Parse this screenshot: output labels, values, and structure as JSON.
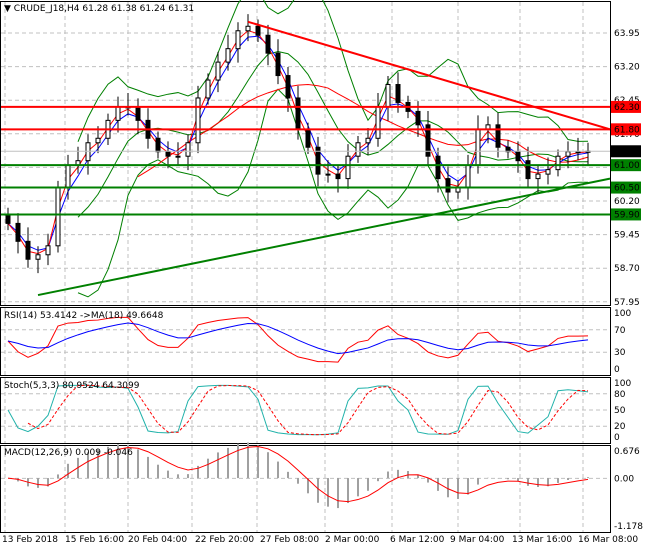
{
  "header": {
    "symbol": "CRUDE_J18,H4",
    "open": "61.28",
    "high": "61.38",
    "low": "61.24",
    "close": "61.31"
  },
  "colors": {
    "bull": "#000000",
    "bear": "#000000",
    "level_red": "#ff0000",
    "level_green": "#008000",
    "bands": "#008000",
    "ma_blue": "#0000ff",
    "ma_red": "#ff0000",
    "stoch_main": "#20b2aa",
    "grid": "#c0c0c0"
  },
  "chart_data": [
    {
      "type": "candlestick",
      "title": "CRUDE_J18,H4",
      "ylim": [
        57.95,
        64.4
      ],
      "y_ticks": [
        "63.95",
        "63.20",
        "62.45",
        "61.70",
        "60.95",
        "60.20",
        "59.45",
        "58.70",
        "57.95"
      ],
      "x_ticks": [
        "13 Feb 2018",
        "15 Feb 16:00",
        "20 Feb 04:00",
        "22 Feb 20:00",
        "27 Feb 08:00",
        "2 Mar 00:00",
        "6 Mar 12:00",
        "9 Mar 04:00",
        "13 Mar 16:00",
        "16 Mar 08:00"
      ],
      "closes": [
        59.7,
        59.3,
        58.9,
        59.0,
        59.2,
        60.5,
        61.0,
        61.1,
        61.5,
        61.6,
        62.0,
        62.3,
        62.3,
        62.0,
        61.6,
        61.3,
        61.2,
        61.2,
        61.5,
        62.5,
        62.9,
        63.3,
        63.6,
        64.0,
        64.1,
        63.9,
        63.5,
        63.0,
        62.5,
        61.8,
        61.4,
        60.8,
        60.8,
        60.7,
        61.2,
        61.5,
        61.6,
        62.3,
        62.8,
        62.4,
        62.2,
        61.9,
        61.2,
        60.7,
        60.4,
        60.5,
        61.0,
        61.8,
        61.9,
        61.4,
        61.3,
        61.1,
        60.7,
        60.8,
        60.9,
        61.2,
        61.3,
        61.3,
        61.31
      ],
      "levels": [
        {
          "value": 62.3,
          "label": "62.30",
          "color": "#ff0000"
        },
        {
          "value": 61.8,
          "label": "61.80",
          "color": "#ff0000"
        },
        {
          "value": 61.0,
          "label": "61.00",
          "color": "#008000"
        },
        {
          "value": 60.5,
          "label": "60.50",
          "color": "#008000"
        },
        {
          "value": 59.9,
          "label": "59.90",
          "color": "#008000"
        }
      ],
      "trendlines": [
        {
          "from": {
            "bar": 24,
            "price": 64.2
          },
          "to": {
            "bar": 61,
            "price": 61.8
          },
          "color": "#ff0000"
        },
        {
          "from": {
            "bar": 3,
            "price": 58.1
          },
          "to": {
            "bar": 61,
            "price": 60.7
          },
          "color": "#008000"
        }
      ],
      "current_price": "61.31"
    },
    {
      "type": "line",
      "title": "RSI(14) 53.4142  ->MA(18) 49.6648",
      "ylim": [
        0,
        100
      ],
      "y_ticks": [
        "100",
        "70",
        "30",
        "0"
      ]
    },
    {
      "type": "line",
      "title": "Stoch(5,3,3) 80.9524 64.3099",
      "ylim": [
        0,
        100
      ],
      "y_ticks": [
        "100",
        "80",
        "50",
        "20",
        "0"
      ]
    },
    {
      "type": "bar",
      "title": "MACD(12,26,9) 0.009 -0.046",
      "ylim": [
        -1.178,
        0.676
      ],
      "y_ticks": [
        "0.676",
        "0.00",
        "-1.178"
      ]
    }
  ]
}
